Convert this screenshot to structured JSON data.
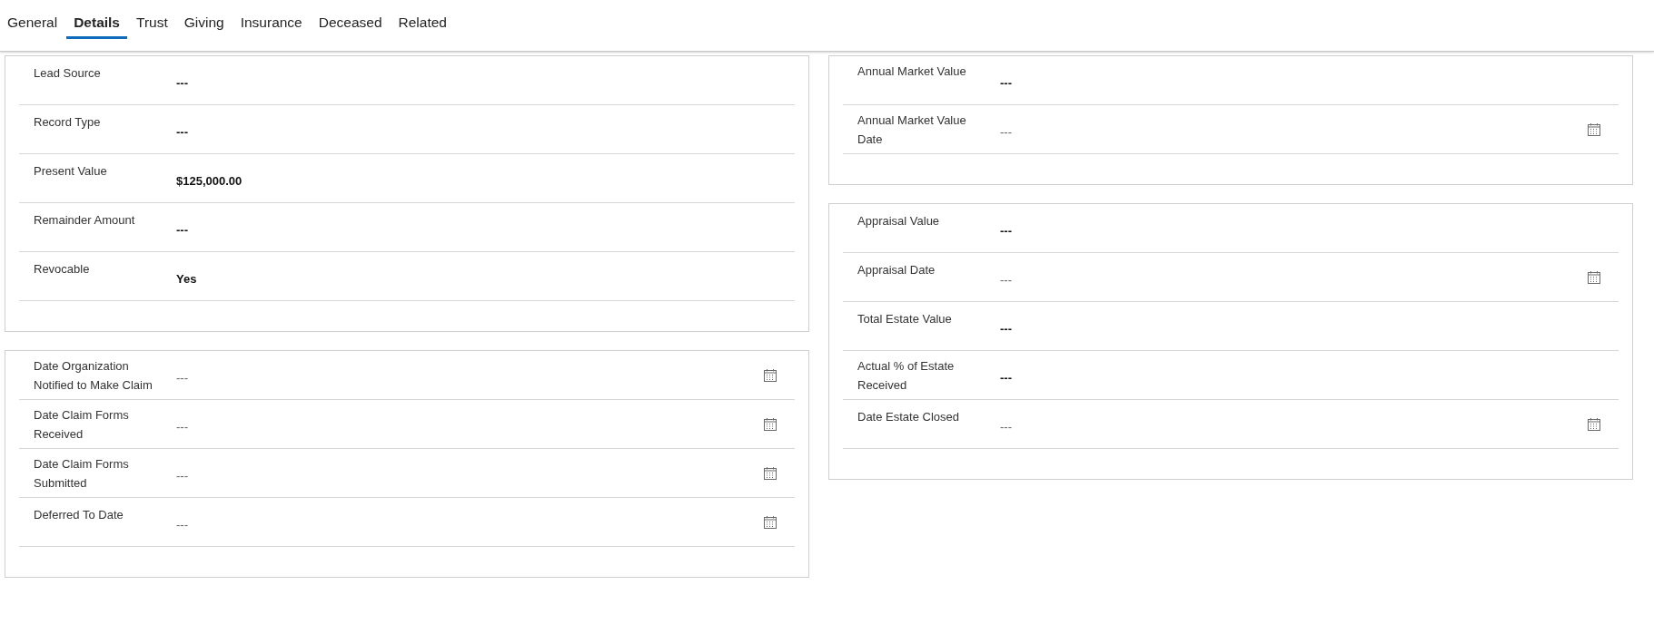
{
  "tabs": [
    {
      "label": "General",
      "selected": false
    },
    {
      "label": "Details",
      "selected": true
    },
    {
      "label": "Trust",
      "selected": false
    },
    {
      "label": "Giving",
      "selected": false
    },
    {
      "label": "Insurance",
      "selected": false
    },
    {
      "label": "Deceased",
      "selected": false
    },
    {
      "label": "Related",
      "selected": false
    }
  ],
  "columns": [
    {
      "sections": [
        {
          "fields": [
            {
              "label": "Lead Source",
              "value": "---",
              "kind": "text"
            },
            {
              "label": "Record Type",
              "value": "---",
              "kind": "text"
            },
            {
              "label": "Present Value",
              "value": "$125,000.00",
              "kind": "text"
            },
            {
              "label": "Remainder Amount",
              "value": "---",
              "kind": "text"
            },
            {
              "label": "Revocable",
              "value": "Yes",
              "kind": "text"
            }
          ]
        },
        {
          "fields": [
            {
              "label": "Date Organization Notified to Make Claim",
              "value": "---",
              "kind": "date"
            },
            {
              "label": "Date Claim Forms Received",
              "value": "---",
              "kind": "date"
            },
            {
              "label": "Date Claim Forms Submitted",
              "value": "---",
              "kind": "date"
            },
            {
              "label": "Deferred To Date",
              "value": "---",
              "kind": "date"
            }
          ]
        }
      ]
    },
    {
      "sections": [
        {
          "fields": [
            {
              "label": "Annual Market Value",
              "value": "---",
              "kind": "text"
            },
            {
              "label": "Annual Market Value Date",
              "value": "---",
              "kind": "date"
            }
          ]
        },
        {
          "fields": [
            {
              "label": "Appraisal Value",
              "value": "---",
              "kind": "text"
            },
            {
              "label": "Appraisal Date",
              "value": "---",
              "kind": "date"
            },
            {
              "label": "Total Estate Value",
              "value": "---",
              "kind": "text"
            },
            {
              "label": "Actual % of Estate Received",
              "value": "---",
              "kind": "text"
            },
            {
              "label": "Date Estate Closed",
              "value": "---",
              "kind": "date"
            }
          ]
        }
      ]
    }
  ]
}
